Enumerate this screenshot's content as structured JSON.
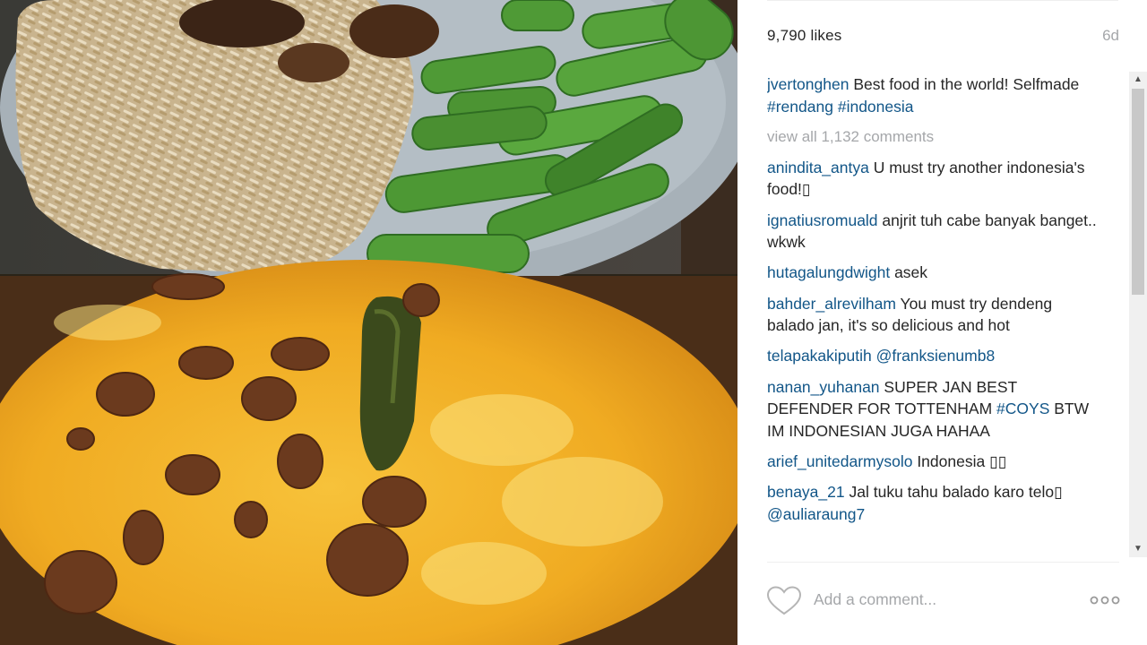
{
  "post": {
    "likes": "9,790 likes",
    "time_ago": "6d"
  },
  "caption": {
    "user": "jvertonghen",
    "text": " Best food in the world! Selfmade ",
    "hashtag1": "#rendang",
    "hashtag2": "#indonesia"
  },
  "view_all": "view all 1,132 comments",
  "comments": [
    {
      "user": "anindita_antya",
      "text": " U must try another indonesia's food!▯"
    },
    {
      "user": "ignatiusromuald",
      "text": " anjrit tuh cabe banyak banget.. wkwk"
    },
    {
      "user": "hutagalungdwight",
      "text": " asek"
    },
    {
      "user": "bahder_alrevilham",
      "text": " You must try dendeng balado jan, it's so delicious and hot"
    },
    {
      "user": "telapakakiputih",
      "mention": "@franksienumb8"
    },
    {
      "user": "nanan_yuhanan",
      "text": " SUPER JAN BEST DEFENDER FOR TOTTENHAM ",
      "hashtag": "#COYS",
      "text2": " BTW IM INDONESIAN JUGA HAHAA"
    },
    {
      "user": "arief_unitedarmysolo",
      "text": " Indonesia ▯▯"
    },
    {
      "user": "benaya_21",
      "text": " Jal tuku tahu balado karo telo▯ ",
      "mention": "@auliaraung7"
    }
  ],
  "add_comment": {
    "placeholder": "Add a comment..."
  },
  "icons": {
    "like": "heart-icon",
    "more": "more-options-icon",
    "scroll_up": "scroll-up-arrow-icon",
    "scroll_down": "scroll-down-arrow-icon"
  },
  "colors": {
    "username": "#125688",
    "muted": "#a5a7aa",
    "text": "#262626"
  }
}
